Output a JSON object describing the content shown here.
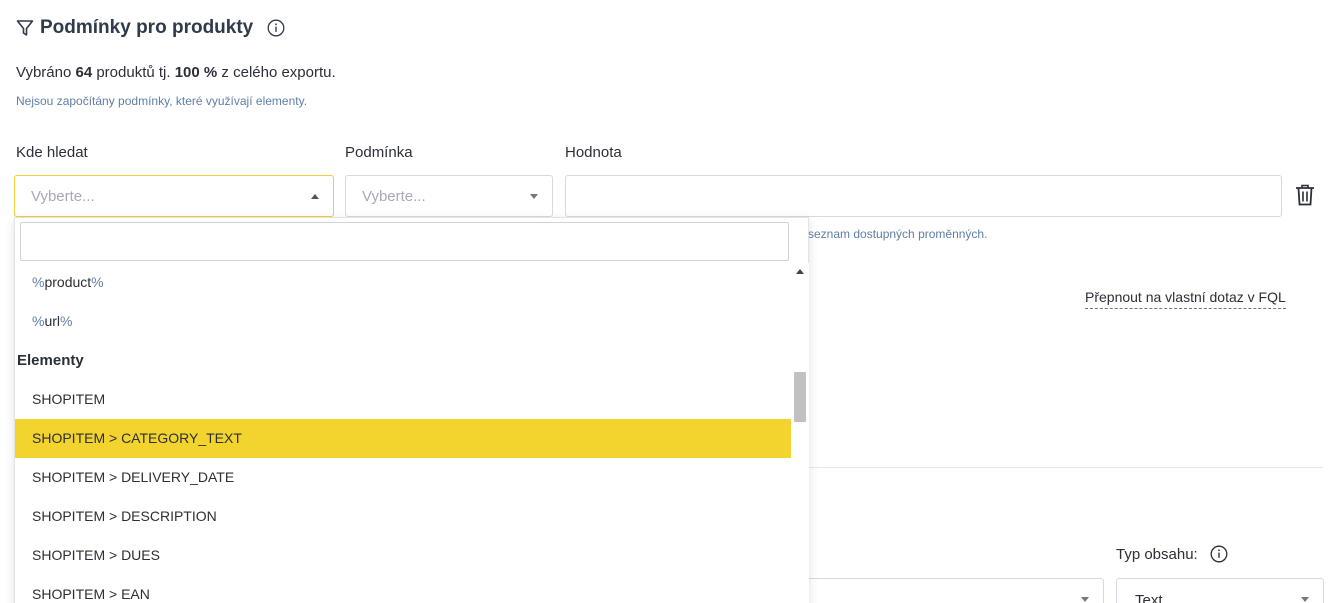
{
  "section": {
    "title": "Podmínky pro produkty",
    "summary_prefix": "Vybráno ",
    "summary_count": "64",
    "summary_mid": " produktů tj. ",
    "summary_percent": "100 %",
    "summary_suffix": " z celého exportu.",
    "note": "Nejsou započítány podmínky, které využívají elementy."
  },
  "condition_row": {
    "where_label": "Kde hledat",
    "where_placeholder": "Vyberte...",
    "condition_label": "Podmínka",
    "condition_placeholder": "Vyberte...",
    "value_label": "Hodnota",
    "value_hint": "seznam dostupných proměnných."
  },
  "fql_link": "Přepnout na vlastní dotaz v FQL",
  "content_type": {
    "label": "Typ obsahu:",
    "value": "Text"
  },
  "dropdown": {
    "search_value": "",
    "vars": [
      {
        "pre": "%",
        "name": "product",
        "post": "%"
      },
      {
        "pre": "%",
        "name": "url",
        "post": "%"
      }
    ],
    "group_label": "Elementy",
    "items": [
      "SHOPITEM",
      "SHOPITEM > CATEGORY_TEXT",
      "SHOPITEM > DELIVERY_DATE",
      "SHOPITEM > DESCRIPTION",
      "SHOPITEM > DUES",
      "SHOPITEM > EAN"
    ],
    "highlighted_index": 1
  },
  "colors": {
    "accent": "#f3d42f",
    "link_blue": "#5f7ea6"
  }
}
